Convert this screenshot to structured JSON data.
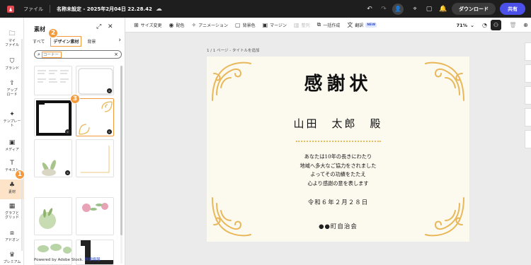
{
  "topbar": {
    "file_menu": "ファイル",
    "doc_title": "名称未設定 - 2025年2月04日 22.28.42",
    "download_label": "ダウンロード",
    "share_label": "共有"
  },
  "toolbar": {
    "resize": "サイズ変更",
    "color": "配色",
    "animation": "アニメーション",
    "bg_color": "背景色",
    "margin": "マージン",
    "arrange": "整列",
    "bulk_create": "一括作成",
    "translate": "翻訳",
    "new_badge": "NEW",
    "zoom": "71%"
  },
  "rail": {
    "items": [
      {
        "label": "マイ\nファイル",
        "icon": "folder-icon"
      },
      {
        "label": "ブランド",
        "icon": "brand-icon"
      },
      {
        "label": "アップ\nロード",
        "icon": "upload-icon"
      },
      {
        "label": "テンプレー\nト",
        "icon": "template-icon"
      },
      {
        "label": "メディア",
        "icon": "media-icon"
      },
      {
        "label": "テキスト",
        "icon": "text-icon"
      },
      {
        "label": "素材",
        "icon": "elements-icon"
      },
      {
        "label": "グラフと\nグリッド",
        "icon": "grid-icon"
      },
      {
        "label": "アドオン",
        "icon": "addon-icon"
      },
      {
        "label": "プレミアム",
        "icon": "premium-icon"
      }
    ]
  },
  "markers": {
    "one": "1",
    "two": "2",
    "three": "3"
  },
  "panel": {
    "title": "素材",
    "tabs": [
      "すべて",
      "デザイン素材",
      "背景"
    ],
    "search_value": "コーナー",
    "footer_text": "Powered by Adobe Stock.",
    "footer_link": "詳細情報"
  },
  "canvas": {
    "page_label": "1 / 1 ページ - タイトルを追加"
  },
  "certificate": {
    "title": "感謝状",
    "name": "山田　太郎　殿",
    "body_lines": [
      "あなたは10年の長きにわたり",
      "地域へ多大なご協力をされました",
      "よってその功績をたたえ",
      "心より感謝の意を表します"
    ],
    "date": "令和６年２月２８日",
    "org": "●●町自治会"
  },
  "colors": {
    "accent": "#f29a3c",
    "share": "#4b51e8",
    "gold": "#e9b85a",
    "page_bg": "#fcf9ef"
  }
}
